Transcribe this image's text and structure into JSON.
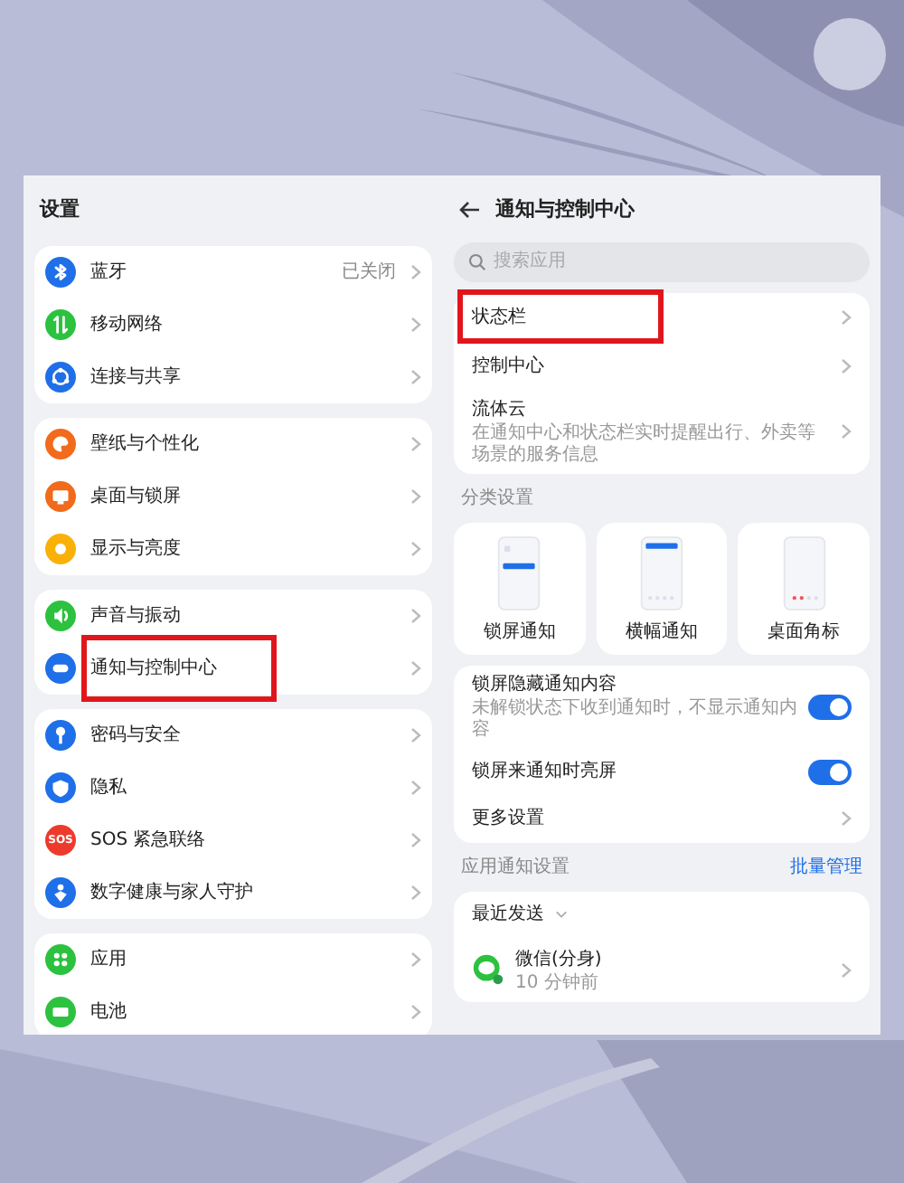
{
  "settings": {
    "title": "设置",
    "groups": [
      [
        {
          "label": "蓝牙",
          "kind": "bluetooth",
          "color": "#1f6fe8",
          "value": "已关闭",
          "highlighted": false
        },
        {
          "label": "移动网络",
          "kind": "arrows",
          "color": "#2cc23f",
          "highlighted": false
        },
        {
          "label": "连接与共享",
          "kind": "share",
          "color": "#1f6fe8",
          "highlighted": false
        }
      ],
      [
        {
          "label": "壁纸与个性化",
          "kind": "palette",
          "color": "#f26a1b",
          "highlighted": false
        },
        {
          "label": "桌面与锁屏",
          "kind": "monitor",
          "color": "#f26a1b",
          "highlighted": false
        },
        {
          "label": "显示与亮度",
          "kind": "sun",
          "color": "#f9b10a",
          "highlighted": false
        }
      ],
      [
        {
          "label": "声音与振动",
          "kind": "speaker",
          "color": "#2cc23f",
          "highlighted": false
        },
        {
          "label": "通知与控制中心",
          "kind": "toggle",
          "color": "#1f6fe8",
          "highlighted": true
        }
      ],
      [
        {
          "label": "密码与安全",
          "kind": "key",
          "color": "#1f6fe8",
          "highlighted": false
        },
        {
          "label": "隐私",
          "kind": "shield",
          "color": "#1f6fe8",
          "highlighted": false
        },
        {
          "label": "SOS 紧急联络",
          "kind": "sos",
          "color": "#ee3a2c",
          "icon_text": "SOS",
          "highlighted": false
        },
        {
          "label": "数字健康与家人守护",
          "kind": "person",
          "color": "#1f6fe8",
          "highlighted": false
        }
      ],
      [
        {
          "label": "应用",
          "kind": "grid",
          "color": "#2cc23f",
          "highlighted": false
        },
        {
          "label": "电池",
          "kind": "battery",
          "color": "#2cc23f",
          "highlighted": false
        }
      ]
    ]
  },
  "detail": {
    "title": "通知与控制中心",
    "search": {
      "placeholder": "搜索应用"
    },
    "main_items": [
      {
        "title": "状态栏",
        "highlighted": true
      },
      {
        "title": "控制中心",
        "highlighted": false
      },
      {
        "title": "流体云",
        "subtitle": "在通知中心和状态栏实时提醒出行、外卖等场景的服务信息",
        "highlighted": false
      }
    ],
    "category_label": "分类设置",
    "categories": [
      {
        "label": "锁屏通知",
        "kind": "lock"
      },
      {
        "label": "横幅通知",
        "kind": "banner"
      },
      {
        "label": "桌面角标",
        "kind": "badge"
      }
    ],
    "options": [
      {
        "kind": "toggle",
        "title": "锁屏隐藏通知内容",
        "subtitle": "未解锁状态下收到通知时，不显示通知内容",
        "on": true
      },
      {
        "kind": "toggle",
        "title": "锁屏来通知时亮屏",
        "on": true
      },
      {
        "kind": "link",
        "title": "更多设置"
      }
    ],
    "app_section": {
      "label": "应用通知设置",
      "action": "批量管理",
      "sort": "最近发送",
      "apps": [
        {
          "name": "微信(分身)",
          "time": "10 分钟前"
        }
      ]
    }
  }
}
